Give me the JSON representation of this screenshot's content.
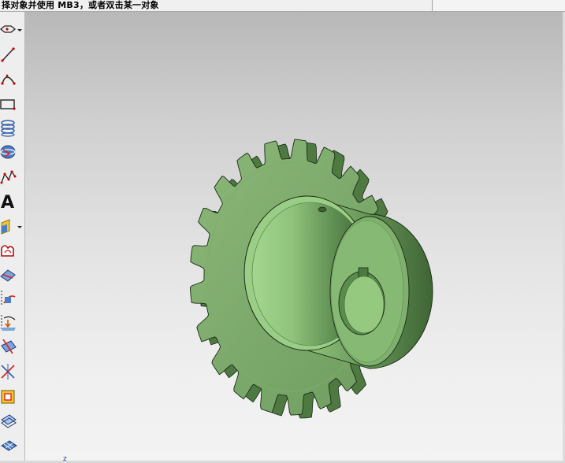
{
  "status": {
    "prompt": "择对象并使用 MB3，或者双击某一对象"
  },
  "toolbar": {
    "tools": [
      {
        "name": "polygon-icon"
      },
      {
        "name": "line-icon"
      },
      {
        "name": "arc-icon"
      },
      {
        "name": "rectangle-icon"
      },
      {
        "name": "helix-icon"
      },
      {
        "name": "sphere-icon"
      },
      {
        "name": "spline-icon"
      },
      {
        "name": "text-icon",
        "label": "A"
      },
      {
        "name": "color-icon"
      },
      {
        "name": "sketch-curve-icon"
      },
      {
        "name": "surface-icon"
      },
      {
        "name": "offset-curve-icon"
      },
      {
        "name": "project-curve-icon"
      },
      {
        "name": "section-curve-icon"
      },
      {
        "name": "intersect-curve-icon"
      },
      {
        "name": "extract-curve-icon"
      },
      {
        "name": "wrap-curve-icon"
      },
      {
        "name": "mesh-surface-icon"
      }
    ]
  },
  "viewport": {
    "model": "sprocket-gear"
  },
  "colors": {
    "gear_fill": "#92c781",
    "gear_dark": "#4e7a42",
    "edge": "#1a2a14"
  }
}
